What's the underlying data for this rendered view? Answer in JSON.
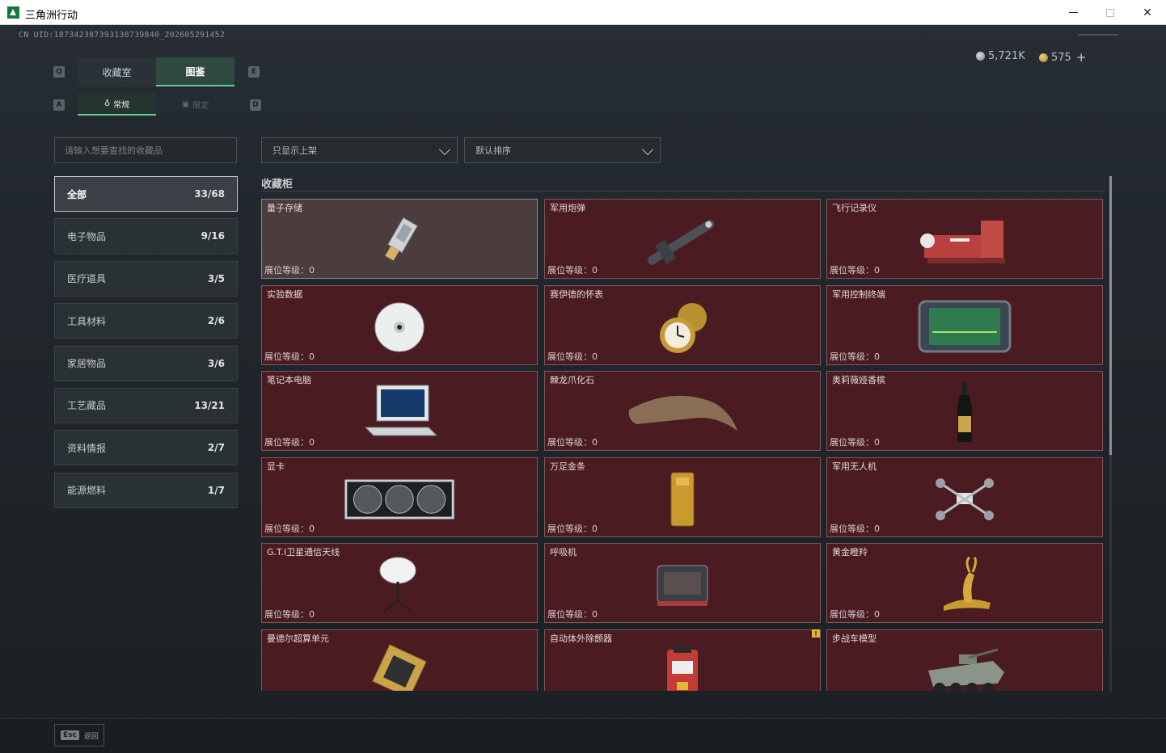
{
  "window": {
    "title": "三角洲行动"
  },
  "header": {
    "uid": "CN UID:18734238739313873984​0_202605291452",
    "silver": "5,721K",
    "gold": "575",
    "plus": "+"
  },
  "keys": {
    "tab_left": "Q",
    "tab_right": "E",
    "sub_left": "A",
    "sub_right": "D"
  },
  "tabs": [
    {
      "label": "收藏室",
      "active": false
    },
    {
      "label": "图鉴",
      "active": true
    }
  ],
  "subtabs": [
    {
      "label": "常规",
      "active": true
    },
    {
      "label": "限定",
      "active": false
    }
  ],
  "search": {
    "placeholder": "请输入想要查找的收藏品"
  },
  "filters": {
    "shelf": "只显示上架",
    "sort": "默认排序"
  },
  "categories": [
    {
      "label": "全部",
      "count": "33/68"
    },
    {
      "label": "电子物品",
      "count": "9/16"
    },
    {
      "label": "医疗道具",
      "count": "3/5"
    },
    {
      "label": "工具材料",
      "count": "2/6"
    },
    {
      "label": "家居物品",
      "count": "3/6"
    },
    {
      "label": "工艺藏品",
      "count": "13/21"
    },
    {
      "label": "资料情报",
      "count": "2/7"
    },
    {
      "label": "能源燃料",
      "count": "1/7"
    }
  ],
  "section_title": "收藏柜",
  "items": [
    {
      "name": "量子存储",
      "level": "展位等级：0",
      "icon": "usb-drive-icon"
    },
    {
      "name": "军用炮弹",
      "level": "展位等级：0",
      "icon": "missile-icon"
    },
    {
      "name": "飞行记录仪",
      "level": "展位等级：0",
      "icon": "flight-recorder-icon"
    },
    {
      "name": "实验数据",
      "level": "展位等级：0",
      "icon": "disc-icon"
    },
    {
      "name": "赛伊德的怀表",
      "level": "展位等级：0",
      "icon": "pocket-watch-icon"
    },
    {
      "name": "军用控制终端",
      "level": "展位等级：0",
      "icon": "control-terminal-icon"
    },
    {
      "name": "笔记本电脑",
      "level": "展位等级：0",
      "icon": "laptop-icon"
    },
    {
      "name": "棘龙爪化石",
      "level": "展位等级：0",
      "icon": "claw-fossil-icon"
    },
    {
      "name": "奥莉薇娅香槟",
      "level": "展位等级：0",
      "icon": "champagne-icon"
    },
    {
      "name": "显卡",
      "level": "展位等级：0",
      "icon": "graphics-card-icon"
    },
    {
      "name": "万足金条",
      "level": "展位等级：0",
      "icon": "gold-bar-icon"
    },
    {
      "name": "军用无人机",
      "level": "展位等级：0",
      "icon": "drone-icon"
    },
    {
      "name": "G.T.I卫星通信天线",
      "level": "展位等级：0",
      "icon": "satellite-dish-icon"
    },
    {
      "name": "呼吸机",
      "level": "展位等级：0",
      "icon": "ventilator-icon"
    },
    {
      "name": "黄金瞪羚",
      "level": "展位等级：0",
      "icon": "gold-gazelle-icon"
    },
    {
      "name": "曼德尔超算单元",
      "level": "",
      "icon": "cpu-icon"
    },
    {
      "name": "自动体外除颤器",
      "level": "",
      "icon": "defibrillator-icon",
      "badge": "!"
    },
    {
      "name": "步战车模型",
      "level": "",
      "icon": "ifv-model-icon"
    }
  ],
  "footer": {
    "esc_key": "Esc",
    "back": "返回"
  },
  "colors": {
    "accent": "#5ed19a",
    "card_bg": "#4a1c22",
    "card_border": "#7b585d"
  }
}
